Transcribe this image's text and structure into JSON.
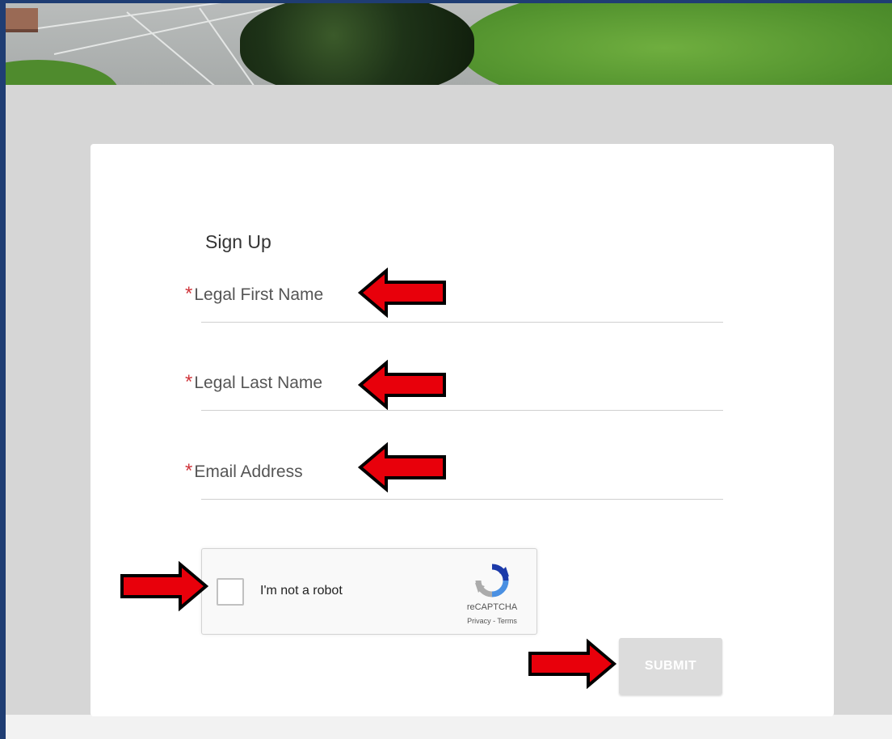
{
  "form": {
    "title": "Sign Up",
    "fields": [
      {
        "label": "Legal First Name",
        "required_marker": "*",
        "value": ""
      },
      {
        "label": "Legal Last Name",
        "required_marker": "*",
        "value": ""
      },
      {
        "label": "Email Address",
        "required_marker": "*",
        "value": ""
      }
    ]
  },
  "recaptcha": {
    "checkbox_label": "I'm not a robot",
    "brand": "reCAPTCHA",
    "links": "Privacy - Terms",
    "checked": false
  },
  "submit": {
    "label": "SUBMIT",
    "enabled": false
  },
  "annotations": {
    "arrow_color": "#e8000b",
    "arrow_outline": "#000000"
  },
  "colors": {
    "required": "#d0363c",
    "frame": "#1f3d73",
    "background": "#d6d6d6"
  }
}
